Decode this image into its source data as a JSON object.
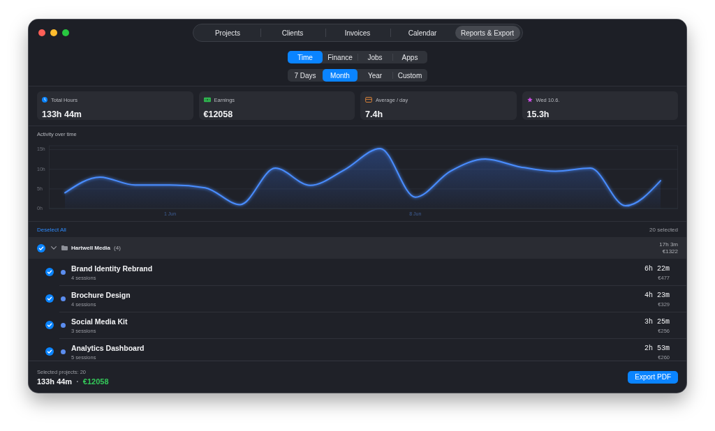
{
  "nav_tabs": [
    {
      "label": "Projects",
      "selected": false
    },
    {
      "label": "Clients",
      "selected": false
    },
    {
      "label": "Invoices",
      "selected": false
    },
    {
      "label": "Calendar",
      "selected": false
    },
    {
      "label": "Reports & Export",
      "selected": true
    }
  ],
  "view_tabs": [
    {
      "label": "Time",
      "selected": true
    },
    {
      "label": "Finance",
      "selected": false
    },
    {
      "label": "Jobs",
      "selected": false
    },
    {
      "label": "Apps",
      "selected": false
    }
  ],
  "period_tabs": [
    {
      "label": "7 Days",
      "selected": false
    },
    {
      "label": "Month",
      "selected": true
    },
    {
      "label": "Year",
      "selected": false
    },
    {
      "label": "Custom",
      "selected": false
    }
  ],
  "stats": [
    {
      "kind": "hours",
      "label": "Total Hours",
      "value": "133h 44m"
    },
    {
      "kind": "earnings",
      "label": "Earnings",
      "value": "€12058"
    },
    {
      "kind": "average",
      "label": "Average / day",
      "value": "7.4h"
    },
    {
      "kind": "best_day",
      "label": "Wed 10.6.",
      "value": "15.3h"
    }
  ],
  "chart": {
    "chart_data": {
      "type": "area",
      "title": "Activity over time",
      "categories": [
        null,
        null,
        null,
        "1 Jun",
        null,
        null,
        null,
        null,
        null,
        null,
        "8 Jun",
        null,
        null,
        null,
        null,
        null,
        null,
        null
      ],
      "values": [
        4.0,
        8.0,
        6.0,
        6.0,
        5.3,
        1.0,
        10.3,
        5.9,
        10.0,
        15.3,
        2.9,
        9.5,
        12.6,
        10.6,
        9.5,
        10.3,
        0.7,
        7.1
      ],
      "ylim": [
        0,
        16
      ],
      "yticks": [
        {
          "value": 0,
          "label": "0h"
        },
        {
          "value": 5,
          "label": "5h"
        },
        {
          "value": 10,
          "label": "10h"
        },
        {
          "value": 15,
          "label": "15h"
        }
      ],
      "grid": true
    }
  },
  "selection": {
    "action": "Deselect All",
    "count": "20 selected"
  },
  "groups": [
    {
      "name": "Hartwell Media",
      "count": "(4)",
      "checked": true,
      "expanded": true,
      "total_time": "17h 3m",
      "total_amount": "€1322",
      "projects": [
        {
          "name": "Brand Identity Rebrand",
          "sessions": "4 sessions",
          "time": "6h 22m",
          "amount": "€477",
          "checked": true,
          "color": "#5b8def"
        },
        {
          "name": "Brochure Design",
          "sessions": "4 sessions",
          "time": "4h 23m",
          "amount": "€329",
          "checked": true,
          "color": "#5b8def"
        },
        {
          "name": "Social Media Kit",
          "sessions": "3 sessions",
          "time": "3h 25m",
          "amount": "€256",
          "checked": true,
          "color": "#5b8def"
        },
        {
          "name": "Analytics Dashboard",
          "sessions": "5 sessions",
          "time": "2h 53m",
          "amount": "€260",
          "checked": true,
          "color": "#5b8def"
        }
      ]
    }
  ],
  "footer": {
    "label": "Selected projects: 20",
    "total_time": "133h 44m",
    "separator": "·",
    "total_amount": "€12058",
    "button": "Export PDF"
  }
}
